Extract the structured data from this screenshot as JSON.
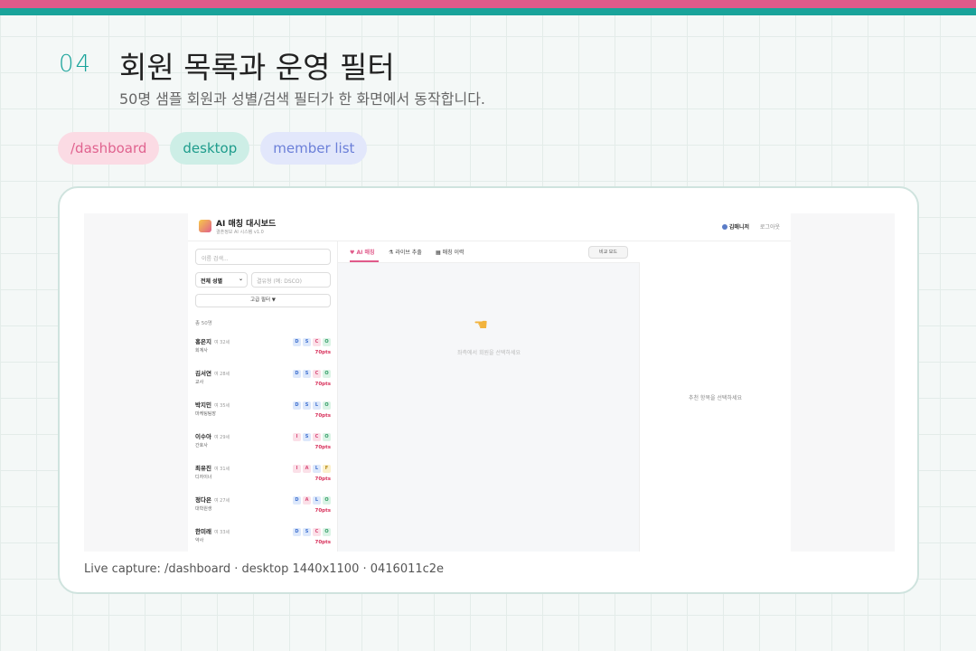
{
  "slide": {
    "number": "04",
    "title": "회원 목록과 운영 필터",
    "subtitle": "50명 샘플 회원과 성별/검색 필터가 한 화면에서 동작합니다.",
    "tags": [
      "/dashboard",
      "desktop",
      "member list"
    ],
    "caption": "Live capture: /dashboard · desktop 1440x1100 · 0416011c2e"
  },
  "colors": {
    "accent_pink": "#e05a8a",
    "accent_teal": "#19a39a"
  },
  "app": {
    "title": "AI 매칭 대시보드",
    "subtitle": "결혼정보 AI 시스템 v1.0",
    "user_name": "김매니저",
    "logout": "로그아웃",
    "sidebar": {
      "search_placeholder": "이름 검색...",
      "gender_select": "전체 성별",
      "type_placeholder": "결유형 (예: DSCO)",
      "advanced_filter": "고급 필터 ▼",
      "total": "총 50명"
    },
    "members": [
      {
        "name": "홍은지",
        "age": "여 32세",
        "job": "회계사",
        "badges": [
          "D",
          "S",
          "C",
          "O"
        ],
        "points": "70pts"
      },
      {
        "name": "김서연",
        "age": "여 28세",
        "job": "교사",
        "badges": [
          "D",
          "S",
          "C",
          "O"
        ],
        "points": "70pts"
      },
      {
        "name": "박지민",
        "age": "여 35세",
        "job": "마케팅팀장",
        "badges": [
          "D",
          "S",
          "L",
          "O"
        ],
        "points": "70pts"
      },
      {
        "name": "이수아",
        "age": "여 29세",
        "job": "간호사",
        "badges": [
          "I",
          "S",
          "C",
          "O"
        ],
        "points": "70pts"
      },
      {
        "name": "최유진",
        "age": "여 31세",
        "job": "디자이너",
        "badges": [
          "I",
          "A",
          "L",
          "F"
        ],
        "points": "70pts"
      },
      {
        "name": "정다은",
        "age": "여 27세",
        "job": "대학원생",
        "badges": [
          "D",
          "A",
          "L",
          "O"
        ],
        "points": "70pts"
      },
      {
        "name": "한미래",
        "age": "여 33세",
        "job": "약사",
        "badges": [
          "D",
          "S",
          "C",
          "O"
        ],
        "points": "70pts"
      }
    ],
    "tabs": [
      "AI 매칭",
      "라이브 추출",
      "매칭 이력"
    ],
    "compare_button": "비교 모드",
    "center_hint": "좌측에서 회원을 선택하세요",
    "right_hint": "추천 항목을 선택하세요"
  }
}
